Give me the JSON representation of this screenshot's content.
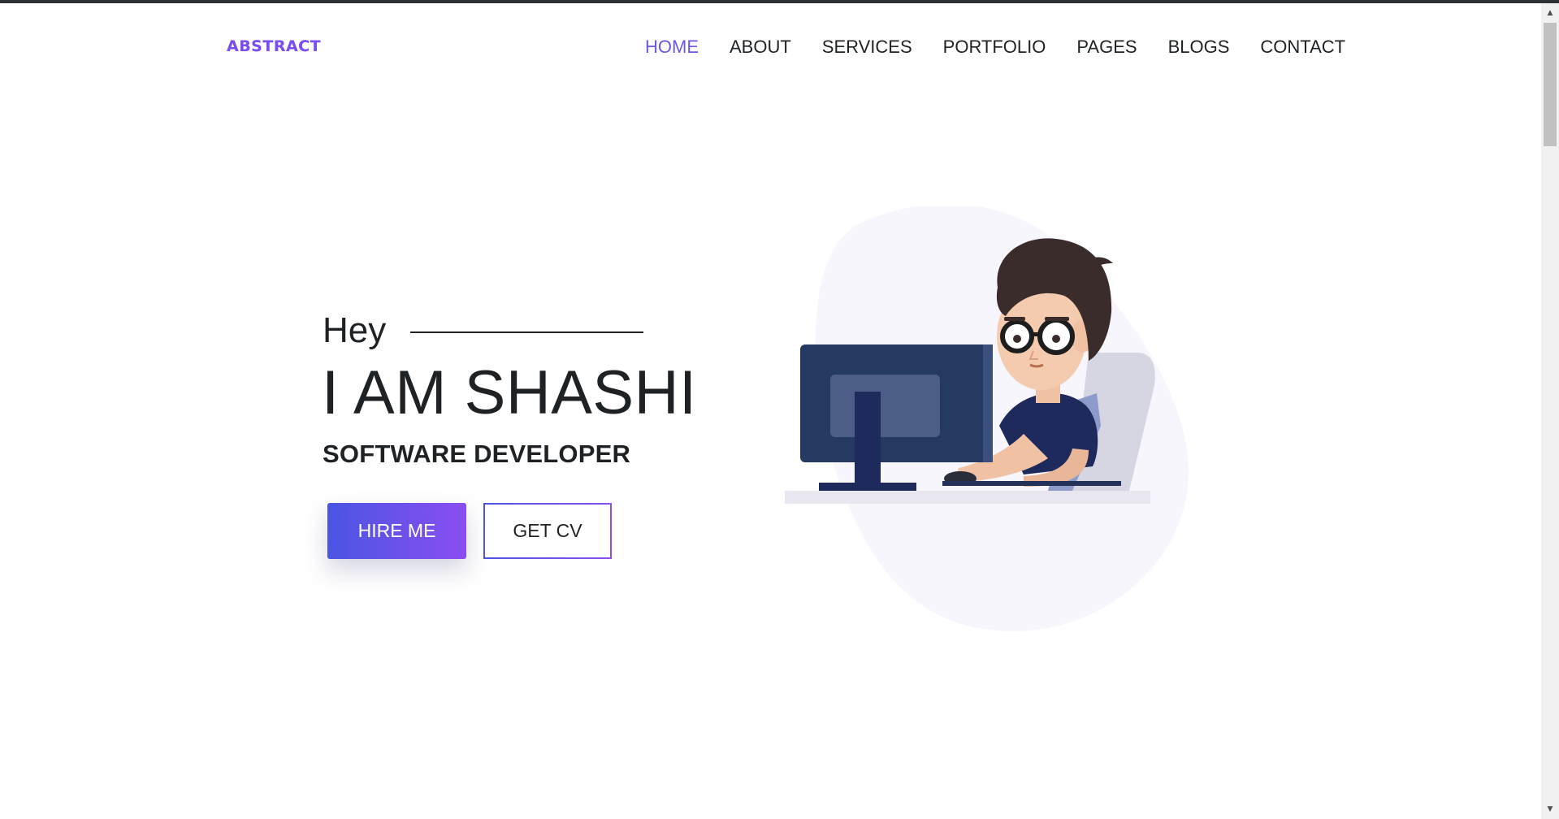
{
  "header": {
    "logo": "ABSTRACT",
    "nav": [
      {
        "label": "HOME",
        "active": true
      },
      {
        "label": "ABOUT",
        "active": false
      },
      {
        "label": "SERVICES",
        "active": false
      },
      {
        "label": "PORTFOLIO",
        "active": false
      },
      {
        "label": "PAGES",
        "active": false
      },
      {
        "label": "BLOGS",
        "active": false
      },
      {
        "label": "CONTACT",
        "active": false
      }
    ]
  },
  "hero": {
    "greeting": "Hey",
    "name": "I AM SHASHI",
    "role": "SOFTWARE DEVELOPER",
    "hire_button": "HIRE ME",
    "cv_button": "GET CV"
  },
  "illustration": {
    "icon": "developer-at-computer-illustration"
  },
  "colors": {
    "accent": "#6b57e6",
    "gradient_start": "#4a55e3",
    "gradient_end": "#8a4ef0",
    "text": "#1f2225"
  }
}
